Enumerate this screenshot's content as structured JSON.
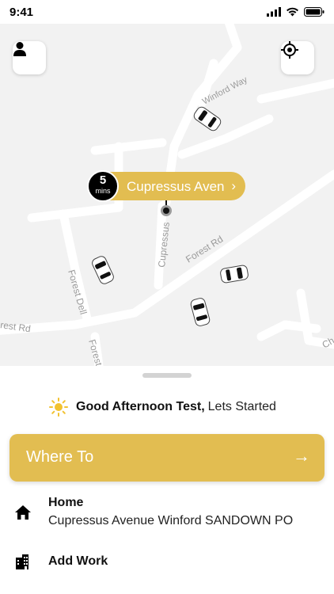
{
  "status_bar": {
    "time": "9:41"
  },
  "map": {
    "street_labels": [
      "Winford Way",
      "Cupressus",
      "Forest Rd",
      "Forest Dell",
      "Forest Rd",
      "Forest",
      "Ch"
    ],
    "eta": {
      "minutes": "5",
      "unit": "mins",
      "destination": "Cupressus Aven",
      "chevron": "›"
    }
  },
  "sheet": {
    "greeting": {
      "bold": "Good Afternoon Test,",
      "rest": "Lets Started"
    },
    "where_to": {
      "label": "Where To",
      "arrow": "→"
    },
    "places": [
      {
        "title": "Home",
        "subtitle": "Cupressus Avenue Winford SANDOWN PO",
        "icon": "home-icon"
      },
      {
        "title": "Add Work",
        "icon": "building-icon"
      }
    ]
  },
  "colors": {
    "accent": "#e2bd51",
    "map_bg": "#f2f2f2",
    "road": "#ffffff",
    "text": "#111111"
  }
}
